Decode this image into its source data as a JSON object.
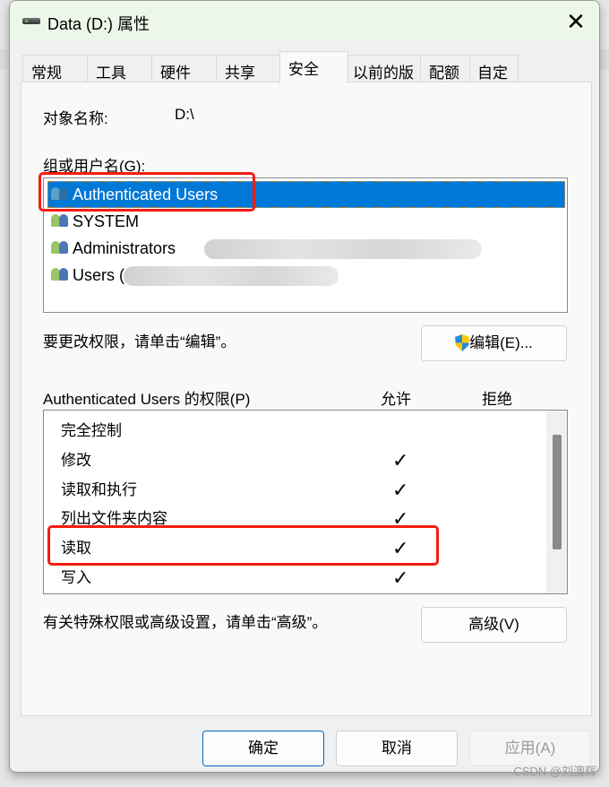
{
  "window": {
    "title": "Data (D:) 属性",
    "close_label": "✕"
  },
  "tabs": [
    {
      "label": "常规"
    },
    {
      "label": "工具"
    },
    {
      "label": "硬件"
    },
    {
      "label": "共享"
    },
    {
      "label": "安全",
      "active": true
    },
    {
      "label": "以前的版本"
    },
    {
      "label": "配额"
    },
    {
      "label": "自定义"
    }
  ],
  "security": {
    "object_label": "对象名称:",
    "object_value": "D:\\",
    "groups_label": "组或用户名(G):",
    "groups": [
      {
        "name": "Authenticated Users",
        "selected": true
      },
      {
        "name": "SYSTEM"
      },
      {
        "name": "Administrators"
      },
      {
        "name": "Users ("
      }
    ],
    "edit_hint": "要更改权限，请单击“编辑”。",
    "edit_button": "编辑(E)...",
    "permissions_label": "Authenticated Users 的权限(P)",
    "allow_header": "允许",
    "deny_header": "拒绝",
    "permissions": [
      {
        "name": "完全控制",
        "allow": false,
        "deny": false
      },
      {
        "name": "修改",
        "allow": true,
        "deny": false
      },
      {
        "name": "读取和执行",
        "allow": true,
        "deny": false
      },
      {
        "name": "列出文件夹内容",
        "allow": true,
        "deny": false
      },
      {
        "name": "读取",
        "allow": true,
        "deny": false
      },
      {
        "name": "写入",
        "allow": true,
        "deny": false
      }
    ],
    "check_glyph": "✓",
    "advanced_hint": "有关特殊权限或高级设置，请单击“高级”。",
    "advanced_button": "高级(V)"
  },
  "footer": {
    "ok": "确定",
    "cancel": "取消",
    "apply": "应用(A)"
  },
  "watermark": "CSDN @刘澳辉",
  "colors": {
    "selection": "#0078d7",
    "annotation": "#f51c10",
    "titlebar": "#ecf7e9"
  }
}
